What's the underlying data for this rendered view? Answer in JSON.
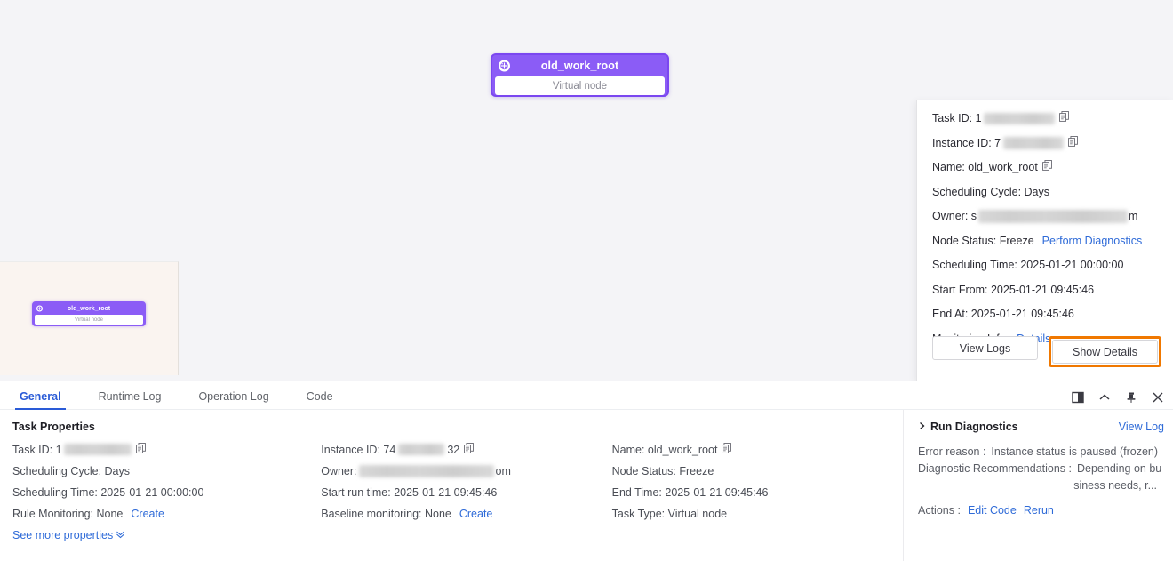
{
  "canvas": {
    "node": {
      "title": "old_work_root",
      "subtitle": "Virtual node",
      "badge_icon": "node-type-icon"
    },
    "minimap": {
      "node_title": "old_work_root",
      "node_subtitle": "Virtual node"
    }
  },
  "popup": {
    "task_id_label": "Task ID: 1",
    "task_id_suffix": "",
    "instance_id_label": "Instance ID: 7",
    "name_label": "Name: old_work_root",
    "scheduling_cycle": "Scheduling Cycle: Days",
    "owner_label": "Owner: s",
    "owner_suffix": "m",
    "node_status": "Node Status: Freeze",
    "perform_diagnostics": "Perform Diagnostics",
    "scheduling_time": "Scheduling Time: 2025-01-21 00:00:00",
    "start_from": "Start From: 2025-01-21 09:45:46",
    "end_at": "End At: 2025-01-21 09:45:46",
    "monitoring_info_label": "Monitoring Info:",
    "monitoring_details_link": "Details",
    "view_logs_button": "View Logs",
    "show_details_button": "Show Details",
    "highlight_color": "#f07800"
  },
  "dock": {
    "tabs": [
      {
        "label": "General",
        "active": true
      },
      {
        "label": "Runtime Log",
        "active": false
      },
      {
        "label": "Operation Log",
        "active": false
      },
      {
        "label": "Code",
        "active": false
      }
    ],
    "controls": [
      {
        "name": "split-panel-icon"
      },
      {
        "name": "chevron-up-icon"
      },
      {
        "name": "pin-icon"
      },
      {
        "name": "close-icon"
      }
    ],
    "properties": {
      "section_title": "Task Properties",
      "task_id": "Task ID: 1",
      "instance_id": "Instance ID: 74",
      "instance_id_suffix": "32",
      "name": "Name: old_work_root",
      "scheduling_cycle": "Scheduling Cycle: Days",
      "owner": "Owner:",
      "owner_suffix": "om",
      "node_status": "Node Status: Freeze",
      "scheduling_time": "Scheduling Time: 2025-01-21 00:00:00",
      "start_run_time": "Start run time: 2025-01-21 09:45:46",
      "end_time": "End Time: 2025-01-21 09:45:46",
      "rule_monitoring": "Rule Monitoring: None",
      "rule_monitoring_link": "Create",
      "baseline_monitoring": "Baseline monitoring: None",
      "baseline_monitoring_link": "Create",
      "task_type": "Task Type: Virtual node",
      "see_more": "See more properties"
    },
    "diagnostics": {
      "title": "Run Diagnostics",
      "view_log_link": "View Log",
      "error_reason_label": "Error reason :",
      "error_reason_value": "Instance status is paused (frozen)",
      "recommendations_label": "Diagnostic Recommendations :",
      "recommendations_value_line1": "Depending on bu",
      "recommendations_value_line2": "siness needs, r...",
      "actions_label": "Actions :",
      "action_edit_code": "Edit Code",
      "action_rerun": "Rerun"
    }
  }
}
